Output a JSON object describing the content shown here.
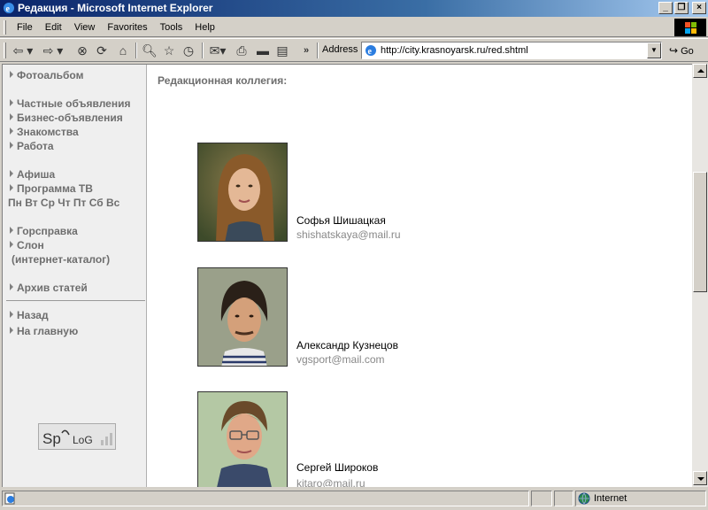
{
  "window": {
    "title": "Редакция - Microsoft Internet Explorer"
  },
  "menu": [
    "File",
    "Edit",
    "View",
    "Favorites",
    "Tools",
    "Help"
  ],
  "address": {
    "label": "Address",
    "url": "http://city.krasnoyarsk.ru/red.shtml",
    "go": "Go"
  },
  "sidebar": {
    "groups": [
      {
        "items": [
          "Фотоальбом"
        ]
      },
      {
        "items": [
          "Частные объявления",
          "Бизнес-объявления",
          "Знакомства",
          "Работа"
        ]
      },
      {
        "items": [
          "Афиша",
          "Программа ТВ"
        ]
      },
      {
        "items": [
          "Горсправка",
          "Слон"
        ]
      },
      {
        "items": [
          "Архив статей"
        ]
      },
      {
        "items": [
          "Назад",
          "На главную"
        ]
      }
    ],
    "tv_days": "Пн Вт Ср Чт Пт Сб Вс",
    "catalog_note": "(интернет-каталог)",
    "counter_logo": "SpyLOG"
  },
  "main": {
    "heading": "Редакционная коллегия:",
    "people": [
      {
        "name": "Софья Шишацкая",
        "email": "shishatskaya@mail.ru"
      },
      {
        "name": "Александр Кузнецов",
        "email": "vgsport@mail.com"
      },
      {
        "name": "Сергей Широков",
        "email": "kitaro@mail.ru"
      }
    ]
  },
  "status": {
    "zone": "Internet"
  }
}
